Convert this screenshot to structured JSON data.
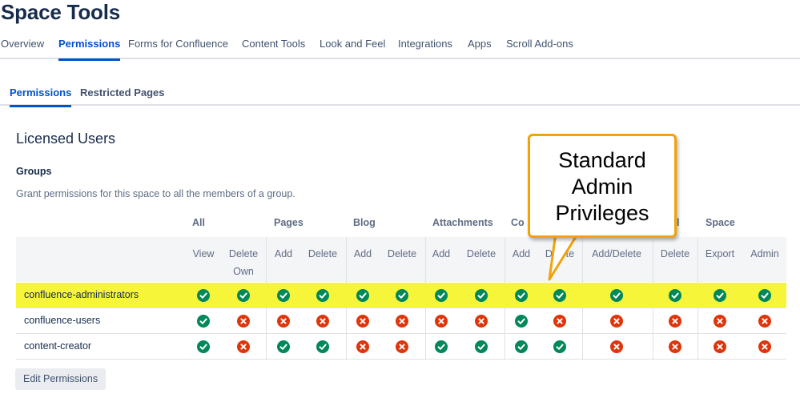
{
  "page_title": "Space Tools",
  "top_tabs": [
    {
      "label": "Overview"
    },
    {
      "label": "Permissions"
    },
    {
      "label": "Forms for Confluence"
    },
    {
      "label": "Content Tools"
    },
    {
      "label": "Look and Feel"
    },
    {
      "label": "Integrations"
    },
    {
      "label": "Apps"
    },
    {
      "label": "Scroll Add-ons"
    }
  ],
  "top_active": "Permissions",
  "sub_tabs": [
    {
      "label": "Permissions"
    },
    {
      "label": "Restricted Pages"
    }
  ],
  "sub_active": "Permissions",
  "section_title": "Licensed Users",
  "groups_title": "Groups",
  "groups_desc": "Grant permissions for this space to all the members of a group.",
  "table": {
    "group_headers": [
      "All",
      "Pages",
      "Blog",
      "Attachments",
      "Co",
      "l",
      "Space"
    ],
    "sub_headers": [
      {
        "label": "View"
      },
      {
        "label": "Delete",
        "label2": "Own"
      },
      {
        "label": "Add"
      },
      {
        "label": "Delete"
      },
      {
        "label": "Add"
      },
      {
        "label": "Delete"
      },
      {
        "label": "Add"
      },
      {
        "label": "Delete"
      },
      {
        "label": "Add"
      },
      {
        "label": "Delete"
      },
      {
        "label": "Add/Delete"
      },
      {
        "label": "Delete"
      },
      {
        "label": "Export"
      },
      {
        "label": "Admin"
      }
    ],
    "rows": [
      {
        "name": "confluence-administrators",
        "highlight": true,
        "perms": [
          true,
          true,
          true,
          true,
          true,
          true,
          true,
          true,
          true,
          true,
          true,
          true,
          true,
          true
        ]
      },
      {
        "name": "confluence-users",
        "highlight": false,
        "perms": [
          true,
          false,
          false,
          false,
          false,
          false,
          false,
          false,
          true,
          false,
          false,
          false,
          false,
          false
        ]
      },
      {
        "name": "content-creator",
        "highlight": false,
        "perms": [
          true,
          false,
          true,
          true,
          false,
          false,
          true,
          true,
          true,
          true,
          false,
          false,
          false,
          false
        ]
      }
    ]
  },
  "edit_button": "Edit Permissions",
  "callout": {
    "lines": [
      "Standard",
      "Admin",
      "Privileges"
    ],
    "border_color": "#f0a30a"
  },
  "colors": {
    "accent": "#0052cc",
    "granted": "#00875a",
    "denied": "#de350b",
    "highlight": "#f7f53a"
  },
  "icons": {
    "granted": "check-circle-icon",
    "denied": "x-circle-icon"
  }
}
